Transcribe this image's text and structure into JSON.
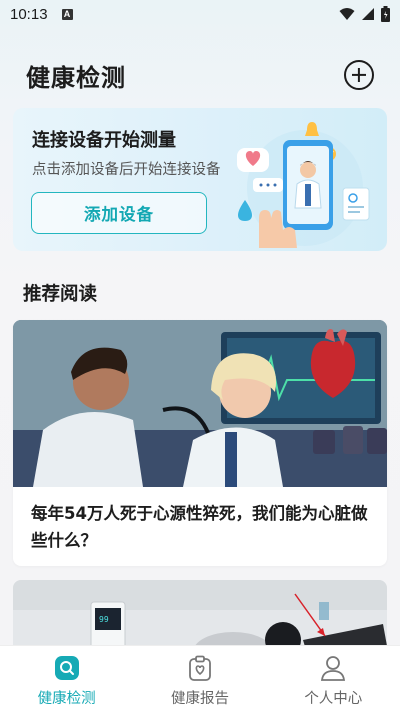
{
  "status_bar": {
    "time": "10:13",
    "notification_badge": "A",
    "icons": [
      "wifi-icon",
      "signal-icon",
      "battery-icon"
    ]
  },
  "header": {
    "title": "健康检测",
    "add_icon": "plus-circle-icon"
  },
  "connect_card": {
    "title": "连接设备开始测量",
    "subtitle": "点击添加设备后开始连接设备",
    "button_label": "添加设备",
    "illustration": "doctor-on-phone-illustration"
  },
  "recommended": {
    "section_title": "推荐阅读",
    "articles": [
      {
        "title": "每年54万人死于心源性猝死，我们能为心脏做些什么？",
        "image": "doctor-stethoscope-heart-illustration"
      },
      {
        "title": "",
        "image": "medical-devices-photo"
      }
    ]
  },
  "bottom_nav": {
    "items": [
      {
        "label": "健康检测",
        "icon": "search-health-icon",
        "active": true
      },
      {
        "label": "健康报告",
        "icon": "clipboard-heart-icon",
        "active": false
      },
      {
        "label": "个人中心",
        "icon": "person-icon",
        "active": false
      }
    ]
  },
  "colors": {
    "accent": "#16aab5",
    "card_background": "#dff1fa",
    "page_background": "#f4f4f6"
  }
}
